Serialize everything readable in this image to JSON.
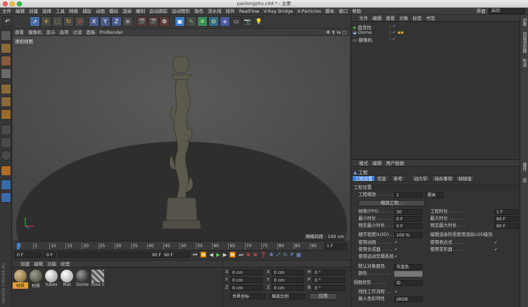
{
  "window": {
    "title": "panlongzhu.c4d * - 主要",
    "interface_label": "界面:",
    "interface_value": "启动"
  },
  "menu": [
    "文件",
    "编辑",
    "创建",
    "选择",
    "工具",
    "网格",
    "捕捉",
    "动画",
    "模拟",
    "渲染",
    "雕刻",
    "运动跟踪",
    "运动图形",
    "角色",
    "流水线",
    "插件",
    "RealFlow",
    "V-Ray Bridge",
    "X-Particles",
    "脚本",
    "窗口",
    "帮助"
  ],
  "viewport": {
    "menu": [
      "查看",
      "摄像机",
      "显示",
      "选项",
      "过滤",
      "面板",
      "ProRender"
    ],
    "label": "透视视图",
    "grid_info": "网格间距 : 100 cm"
  },
  "timeline": {
    "ticks": [
      "0",
      "5",
      "10",
      "15",
      "20",
      "25",
      "30",
      "35",
      "40",
      "45",
      "50",
      "55",
      "60",
      "65",
      "70",
      "75",
      "80",
      "85",
      "90"
    ],
    "frame_indicator": "1 F"
  },
  "transport": {
    "start": "0 F",
    "current": "0 F",
    "end": "90 F",
    "end2": "90 F"
  },
  "materials": {
    "menu": [
      "创建",
      "编辑",
      "功能",
      "纹理"
    ],
    "items": [
      "材质",
      "材质",
      "tubes",
      "Mat",
      "Dome",
      "floor.n"
    ]
  },
  "coords": {
    "rows": [
      {
        "axis": "X",
        "pos": "0 cm",
        "axis2": "X",
        "scale": "0 cm",
        "rot_axis": "H",
        "rot": "0 °"
      },
      {
        "axis": "Y",
        "pos": "0 cm",
        "axis2": "Y",
        "scale": "0 cm",
        "rot_axis": "P",
        "rot": "0 °"
      },
      {
        "axis": "Z",
        "pos": "0 cm",
        "axis2": "Z",
        "scale": "0 cm",
        "rot_axis": "B",
        "rot": "0 °"
      }
    ],
    "world_label": "世界坐标",
    "scale_label": "缩放比例",
    "apply_label": "应用"
  },
  "objects": {
    "menu": [
      "文件",
      "编辑",
      "查看",
      "对象",
      "标签",
      "书签"
    ],
    "items": [
      "盘龙柱",
      "Dome",
      "摄像机"
    ]
  },
  "attributes": {
    "menu": [
      "模式",
      "编辑",
      "用户数据"
    ],
    "title": "工程",
    "tabs": [
      "工程设置",
      "信息",
      "参考",
      "动力学",
      "待办事项",
      "帧插值"
    ],
    "section": "工程设置",
    "scale_label": "工程缩放 . . . . . .",
    "scale_value": "1",
    "scale_unit": "厘米",
    "scale_button": "缩放工程...",
    "fps_label": "帧率(FPS) . . . . .",
    "fps_value": "30",
    "project_time_label": "工程时长 . . . . .",
    "project_time_value": "1 F",
    "min_time_label": "最小时长 . . . . .",
    "min_time_value": "0 F",
    "max_time_label": "最大时长 . . . . .",
    "max_time_value": "90 F",
    "preview_min_label": "预览最小时长 . . .",
    "preview_min_value": "0 F",
    "preview_max_label": "预览最大时长 . . .",
    "preview_max_value": "90 F",
    "lod_label": "细节程度(LOD) . . .",
    "lod_value": "100 %",
    "lod_render_label": "编辑渲染检视使用渲染LOD级别",
    "use_anim_label": "使用动画 . . . . .",
    "use_expr_label": "使用表达式 . . . .",
    "use_gen_label": "使用生成器 . . . .",
    "use_deform_label": "使用变形器 . . . .",
    "use_motion_label": "使用运动剪辑系统",
    "default_color_label": "默认对象颜色",
    "default_color_value": "灰蓝色",
    "color_label": "颜色 . . . . . . . .",
    "view_clip_label": "视图修剪 . . . . .",
    "view_clip_value": "中",
    "linear_flow_label": "线性工作流程 . .",
    "input_color_label": "输入色彩特性",
    "input_color_value": "sRGB"
  },
  "right_strip": [
    "对象",
    "内容浏览器",
    "构造",
    "属性",
    "层"
  ],
  "colors": {
    "accent": "#3f7fd9",
    "checkmark": "#e0e0e0"
  }
}
